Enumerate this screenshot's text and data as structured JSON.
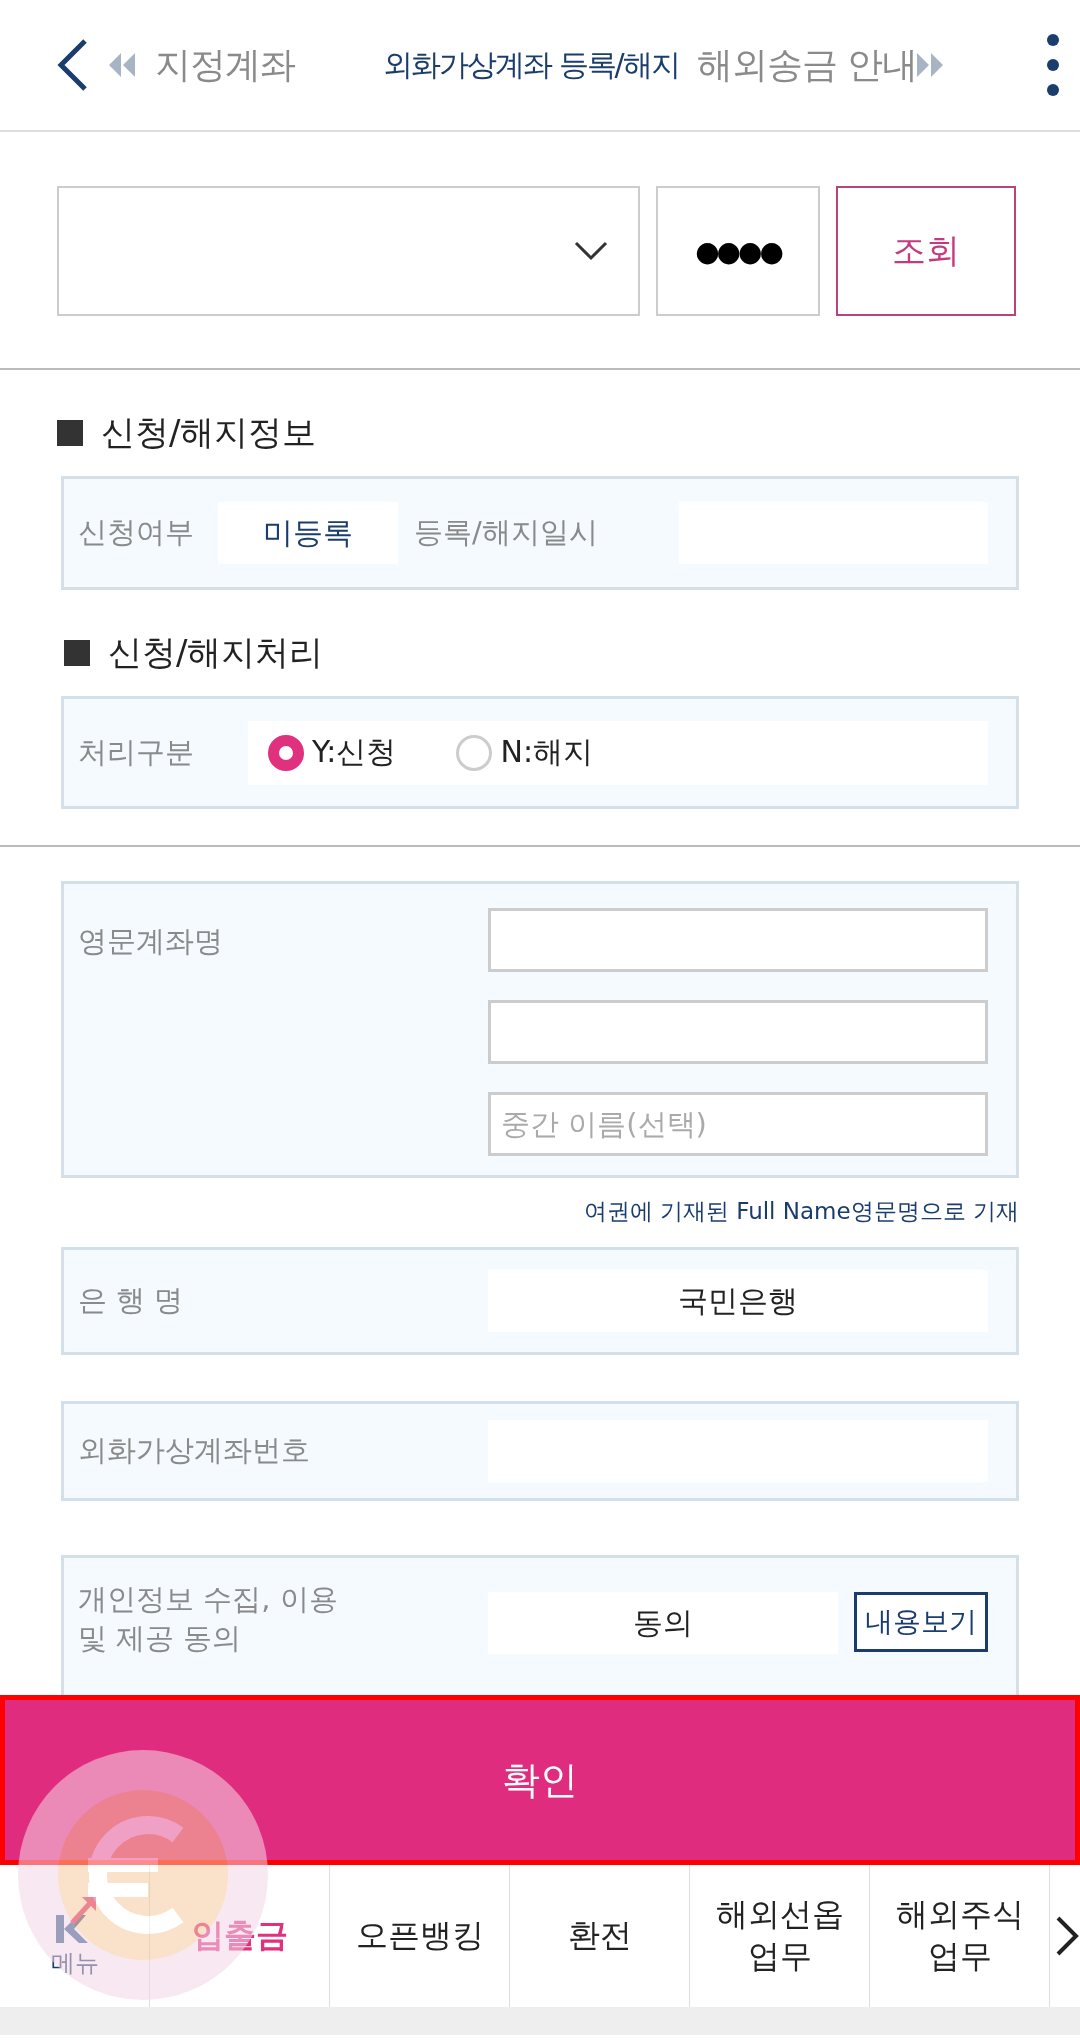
{
  "header": {
    "tabs": [
      {
        "label": "지정계좌",
        "selected": false
      },
      {
        "label": "외화가상계좌 등록/해지",
        "selected": true
      },
      {
        "label": "해외송금 안내",
        "selected": false
      }
    ]
  },
  "query": {
    "password": "●●●●",
    "button": "조회"
  },
  "status_section": {
    "title": "신청/해지정보",
    "label": "신청여부",
    "value": "미등록",
    "date_label": "등록/해지일시"
  },
  "process_section": {
    "title": "신청/해지처리",
    "label": "처리구분",
    "options": [
      {
        "label": "Y:신청",
        "selected": true
      },
      {
        "label": "N:해지",
        "selected": false
      }
    ]
  },
  "name_section": {
    "label": "영문계좌명",
    "middle_placeholder": "중간 이름(선택)",
    "note": "여권에 기재된 Full Name영문명으로 기재"
  },
  "bank": {
    "label": "은 행 명",
    "value": "국민은행"
  },
  "virtual_account": {
    "label": "외화가상계좌번호"
  },
  "privacy": {
    "label": "개인정보 수집, 이용\n및 제공 동의",
    "value": "동의",
    "button": "내용보기"
  },
  "confirm": "확인",
  "bottom_nav": {
    "menu": "메뉴",
    "items": [
      {
        "label": "입출금",
        "selected": true
      },
      {
        "label": "오픈뱅킹",
        "selected": false
      },
      {
        "label": "환전",
        "selected": false
      },
      {
        "label": "해외선옵\n업무",
        "selected": false
      },
      {
        "label": "해외주식\n업무",
        "selected": false
      }
    ]
  }
}
